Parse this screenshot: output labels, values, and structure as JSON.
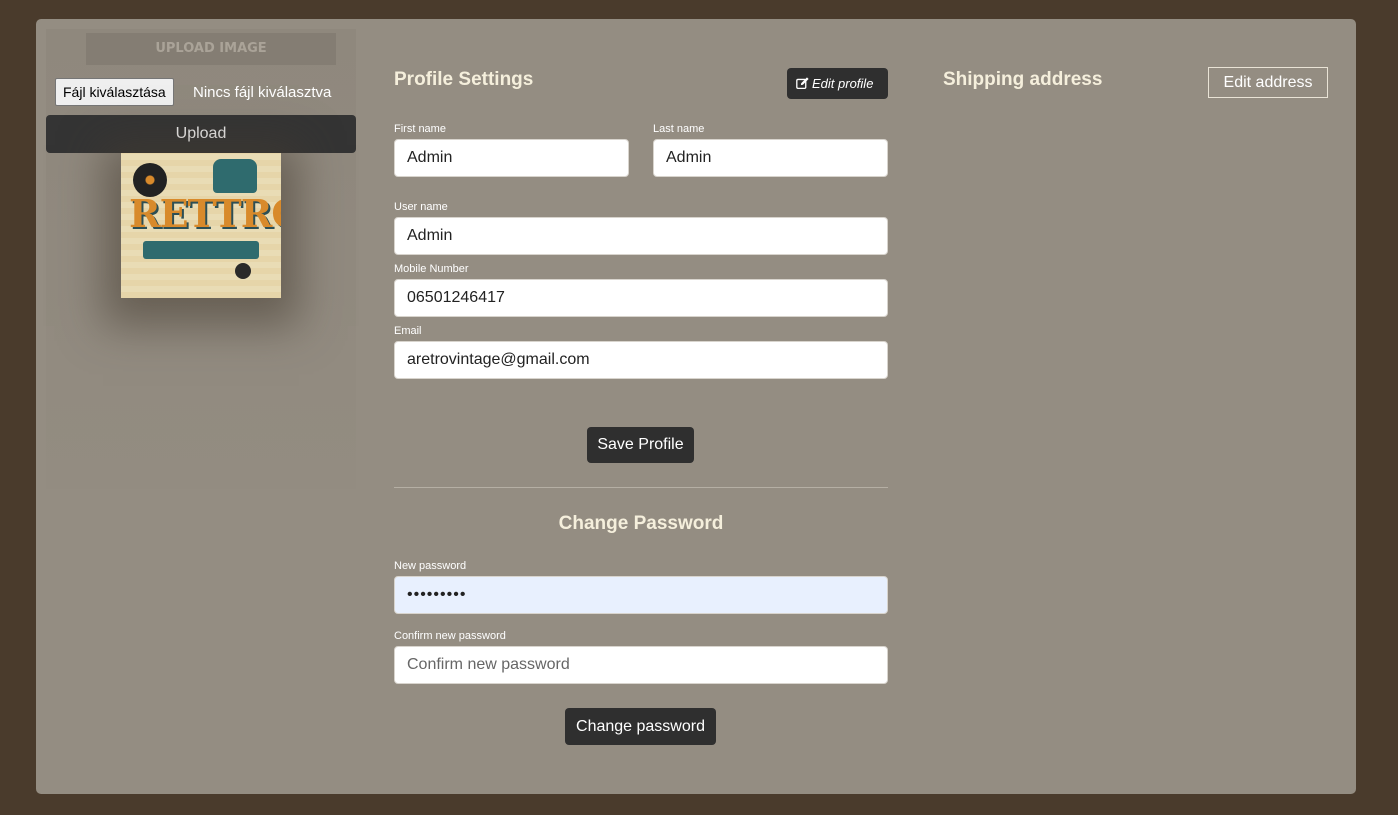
{
  "upload": {
    "title": "UPLOAD IMAGE",
    "file_button": "Fájl kiválasztása",
    "file_status": "Nincs fájl kiválasztva",
    "upload_button": "Upload",
    "logo_text": "RETTRO"
  },
  "profile": {
    "title": "Profile Settings",
    "edit_button": "Edit profile",
    "first_name_label": "First name",
    "first_name_value": "Admin",
    "last_name_label": "Last name",
    "last_name_value": "Admin",
    "username_label": "User name",
    "username_value": "Admin",
    "mobile_label": "Mobile Number",
    "mobile_value": "06501246417",
    "email_label": "Email",
    "email_value": "aretrovintage@gmail.com",
    "save_button": "Save Profile"
  },
  "password": {
    "title": "Change Password",
    "new_label": "New password",
    "new_value": "•••••••••",
    "confirm_label": "Confirm new password",
    "confirm_placeholder": "Confirm new password",
    "change_button": "Change password"
  },
  "shipping": {
    "title": "Shipping address",
    "edit_button": "Edit address"
  },
  "colors": {
    "page_bg": "#4a3b2c",
    "card_bg": "#948d82",
    "button_dark": "#2f2f2f",
    "title_text": "#f5efdc"
  }
}
